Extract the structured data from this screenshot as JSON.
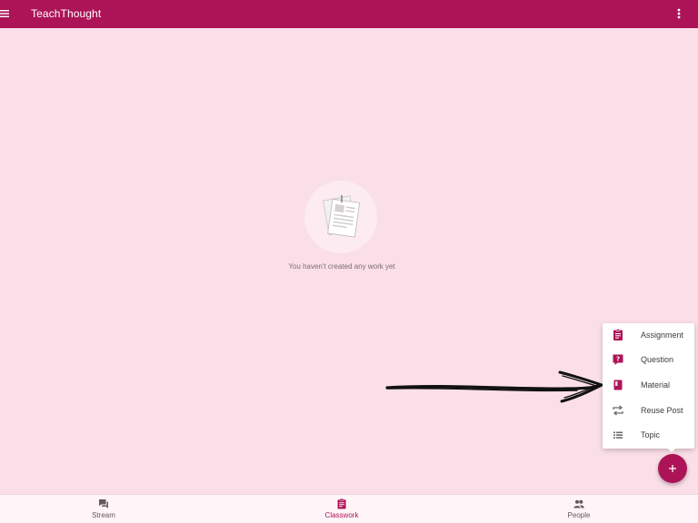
{
  "app_bar": {
    "title": "TeachThought",
    "menu_icon": "hamburger-menu-icon",
    "more_icon": "more-vert-icon"
  },
  "empty_state": {
    "icon": "assignment-papers-illustration",
    "message": "You haven't created any work yet"
  },
  "create_menu": {
    "items": [
      {
        "label": "Assignment",
        "icon": "assignment-icon"
      },
      {
        "label": "Question",
        "icon": "question-icon"
      },
      {
        "label": "Material",
        "icon": "material-icon"
      },
      {
        "label": "Reuse Post",
        "icon": "repeat-icon"
      },
      {
        "label": "Topic",
        "icon": "list-icon"
      }
    ]
  },
  "fab": {
    "label": "+",
    "icon": "add-icon"
  },
  "bottom_nav": {
    "items": [
      {
        "label": "Stream",
        "icon": "chat-icon",
        "active": false
      },
      {
        "label": "Classwork",
        "icon": "assignment-icon",
        "active": true
      },
      {
        "label": "People",
        "icon": "people-icon",
        "active": false
      }
    ]
  },
  "colors": {
    "primary": "#ad1457",
    "background": "#fbdfe8",
    "surface": "#ffffff",
    "nav_background": "#fff5f8"
  }
}
